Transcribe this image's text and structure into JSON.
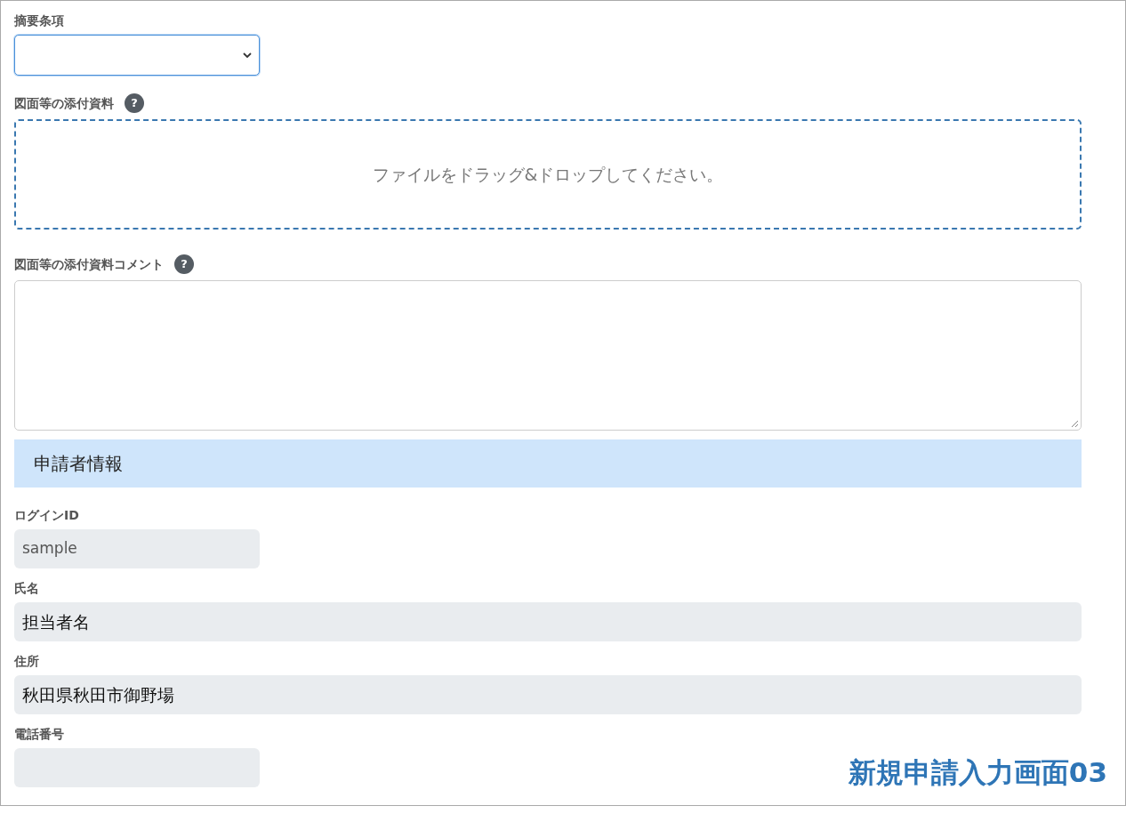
{
  "form": [
    {
      "kind": "select",
      "label": "摘要条項",
      "focused": true
    },
    {
      "kind": "dropzone",
      "label": "図面等の添付資料",
      "help": "?",
      "text": "ファイルをドラッグ&ドロップしてください。"
    },
    {
      "kind": "textarea",
      "label": "図面等の添付資料コメント",
      "help": "?"
    },
    {
      "kind": "header",
      "text": "申請者情報"
    },
    {
      "kind": "short_input",
      "label": "ログインID",
      "value": "sample",
      "disabled": true
    },
    {
      "kind": "input",
      "label": "氏名",
      "value": "担当者名",
      "disabled": true
    },
    {
      "kind": "input",
      "label": "住所",
      "value": "秋田県秋田市御野場",
      "disabled": true
    },
    {
      "kind": "short_input",
      "label": "電話番号",
      "disabled": true
    }
  ],
  "caption": "新規申請入力画面03"
}
